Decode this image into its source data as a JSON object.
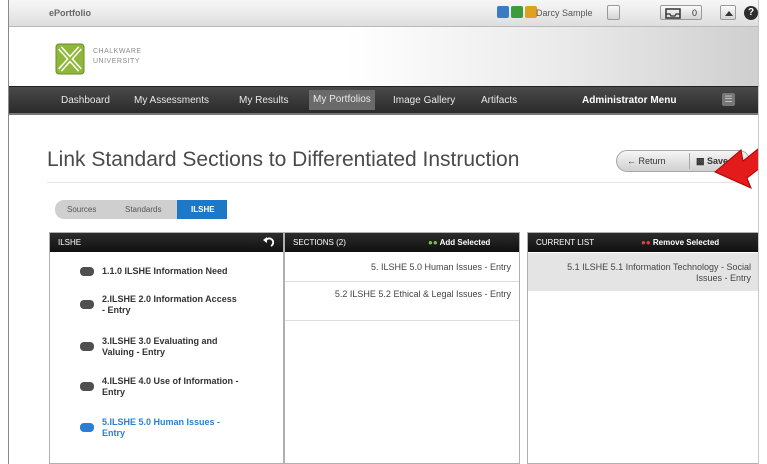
{
  "topbar": {
    "app_title": "ePortfolio",
    "user_name": "Darcy Sample",
    "inbox_count": "0",
    "help_label": "?"
  },
  "logo": {
    "line1": "CHALKWARE",
    "line2": "UNIVERSITY"
  },
  "nav": {
    "items": [
      {
        "label": "Dashboard"
      },
      {
        "label": "My Assessments"
      },
      {
        "label": "My Results"
      },
      {
        "label": "My Portfolios"
      },
      {
        "label": "Image Gallery"
      },
      {
        "label": "Artifacts"
      }
    ],
    "admin_label": "Administrator Menu"
  },
  "page": {
    "title": "Link Standard Sections to Differentiated Instruction",
    "return_label": "Return",
    "save_label": "Save"
  },
  "breadcrumb": {
    "items": [
      "Sources",
      "Standards",
      "ILSHE"
    ]
  },
  "panel_left": {
    "title": "ILSHE",
    "items": [
      {
        "label": "1.1.0 ILSHE Information Need"
      },
      {
        "label": "2.ILSHE 2.0 Information Access - Entry"
      },
      {
        "label": "3.ILSHE 3.0 Evaluating and Valuing - Entry"
      },
      {
        "label": "4.ILSHE 4.0 Use of Information - Entry"
      },
      {
        "label": "5.ILSHE 5.0 Human Issues - Entry"
      }
    ]
  },
  "panel_sections": {
    "title": "SECTIONS (2)",
    "action": "Add Selected",
    "rows": [
      {
        "label": "5. ILSHE 5.0 Human Issues - Entry"
      },
      {
        "label": "5.2 ILSHE 5.2 Ethical & Legal Issues - Entry"
      }
    ]
  },
  "panel_current": {
    "title": "CURRENT LIST",
    "action": "Remove Selected",
    "rows": [
      {
        "label": "5.1 ILSHE 5.1 Information Technology - Social Issues - Entry"
      }
    ]
  },
  "colors": {
    "accent_blue": "#1e78c8",
    "nav_dark": "#2a2a2a",
    "callout_red": "#e31b1b"
  }
}
